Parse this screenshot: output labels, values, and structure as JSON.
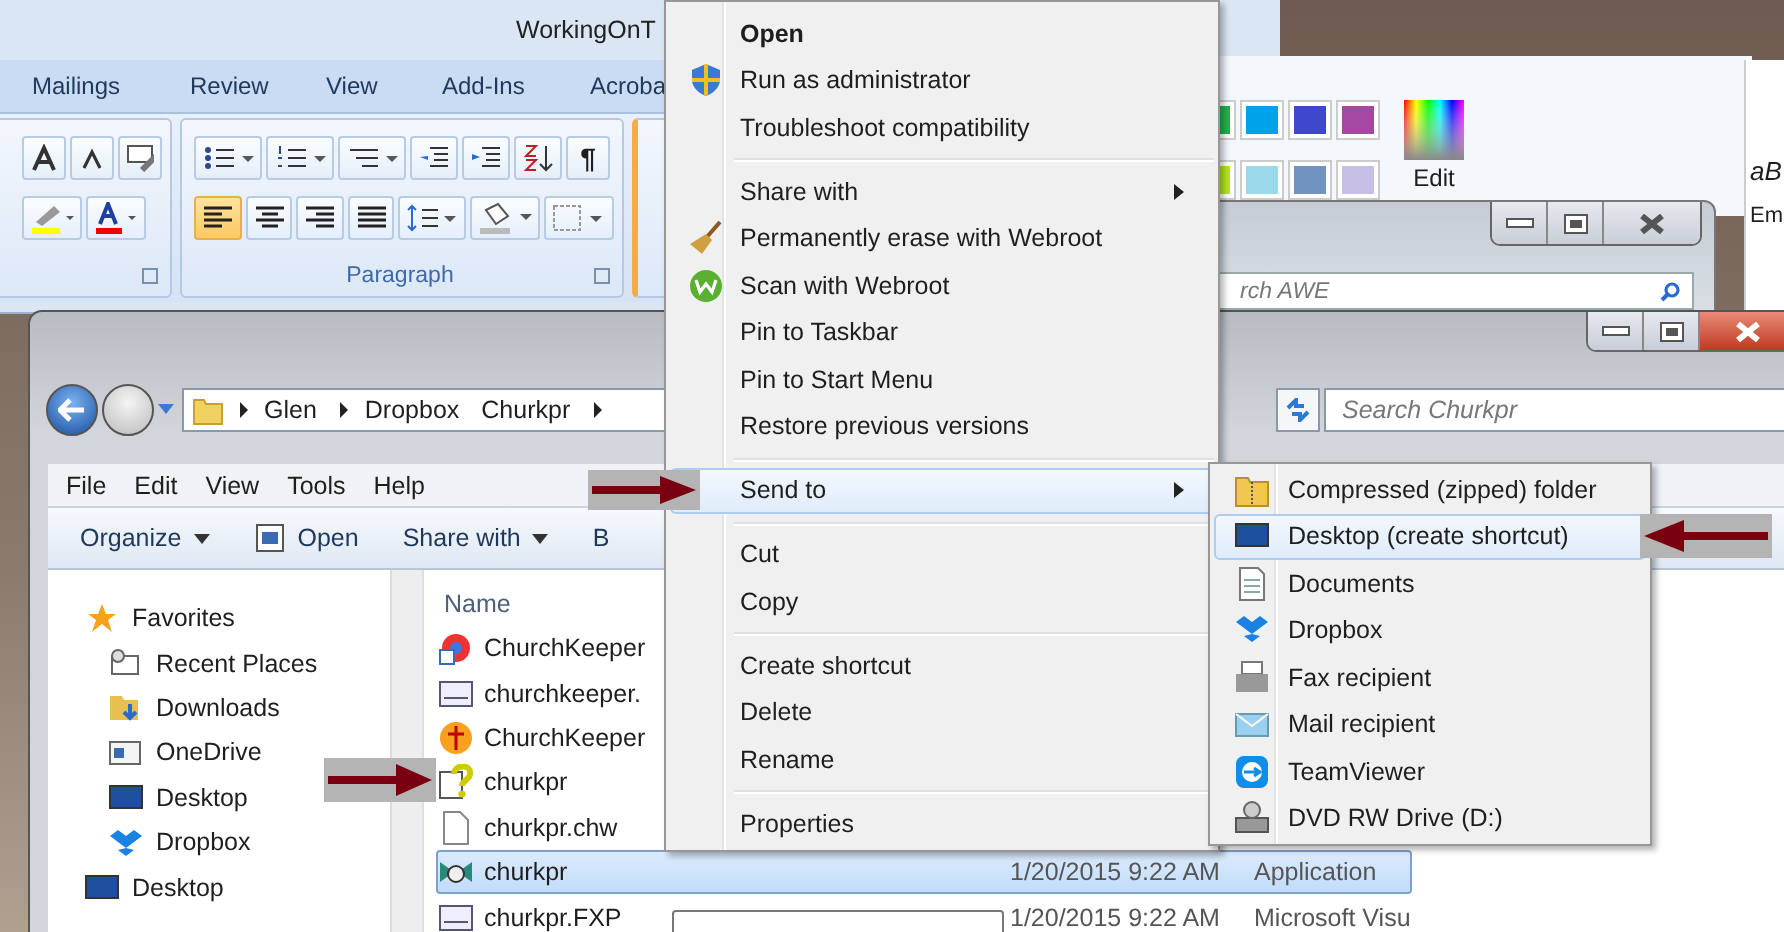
{
  "word_window": {
    "title": "WorkingOnT",
    "tabs": [
      "Mailings",
      "Review",
      "View",
      "Add-Ins",
      "Acroba"
    ],
    "show_marks_glyph": "¶",
    "group_label": "Paragraph",
    "alignments": [
      {
        "selected": true
      },
      {
        "selected": false
      },
      {
        "selected": false
      },
      {
        "selected": false
      }
    ]
  },
  "paint_window": {
    "edit_label": "Edit",
    "palette": [
      {
        "color": "#22b14c"
      },
      {
        "color": "#00a2e8"
      },
      {
        "color": "#3f48cc"
      },
      {
        "color": "#a349a4"
      },
      {
        "color": "#b5e61d"
      },
      {
        "color": "#99d9ea"
      },
      {
        "color": "#7092be"
      },
      {
        "color": "#c8bfe7"
      }
    ]
  },
  "awe_window": {
    "search_text": "rch AWE"
  },
  "document_edge_texts": [
    "aB",
    "Em"
  ],
  "explorer": {
    "breadcrumb": [
      {
        "label": "Glen",
        "arrow_before": true
      },
      {
        "label": "Dropbox",
        "arrow_before": true
      },
      {
        "label": "Churkpr",
        "arrow_before": false
      }
    ],
    "search_placeholder": "Search Churkpr",
    "menu": [
      "File",
      "Edit",
      "View",
      "Tools",
      "Help"
    ],
    "toolbar": [
      {
        "label": "Organize",
        "dropdown": true
      },
      {
        "label": "Open",
        "dropdown": false
      },
      {
        "label": "Share with",
        "dropdown": true
      },
      {
        "label": "B",
        "dropdown": false
      }
    ],
    "nav": [
      {
        "label": "Favorites",
        "kind": "header"
      },
      {
        "label": "Recent Places",
        "kind": "item"
      },
      {
        "label": "Downloads",
        "kind": "item"
      },
      {
        "label": "OneDrive",
        "kind": "item"
      },
      {
        "label": "Desktop",
        "kind": "item"
      },
      {
        "label": "Dropbox",
        "kind": "item"
      },
      {
        "label": "Desktop",
        "kind": "header"
      }
    ],
    "column": "Name",
    "files": [
      {
        "name": "ChurchKeeper",
        "selected": false
      },
      {
        "name": "churchkeeper.",
        "selected": false
      },
      {
        "name": "ChurchKeeper",
        "selected": false
      },
      {
        "name": "churkpr",
        "selected": false
      },
      {
        "name": "churkpr.chw",
        "selected": false
      },
      {
        "name": "churkpr",
        "date": "1/20/2015 9:22 AM",
        "type": "Application",
        "selected": true
      },
      {
        "name": "churkpr.FXP",
        "date": "1/20/2015 9:22 AM",
        "type": "Microsoft Visu",
        "selected": false
      }
    ]
  },
  "context_menu": {
    "items": [
      {
        "kind": "item",
        "label": "Open",
        "bold": true,
        "submenu": false,
        "selected": false
      },
      {
        "kind": "item",
        "label": "Run as administrator",
        "bold": false,
        "submenu": false,
        "selected": false
      },
      {
        "kind": "item",
        "label": "Troubleshoot compatibility",
        "bold": false,
        "submenu": false,
        "selected": false
      },
      {
        "kind": "separator"
      },
      {
        "kind": "item",
        "label": "Share with",
        "bold": false,
        "submenu": true,
        "selected": false
      },
      {
        "kind": "item",
        "label": "Permanently erase with Webroot",
        "bold": false,
        "submenu": false,
        "selected": false
      },
      {
        "kind": "item",
        "label": "Scan with Webroot",
        "bold": false,
        "submenu": false,
        "selected": false
      },
      {
        "kind": "item",
        "label": "Pin to Taskbar",
        "bold": false,
        "submenu": false,
        "selected": false
      },
      {
        "kind": "item",
        "label": "Pin to Start Menu",
        "bold": false,
        "submenu": false,
        "selected": false
      },
      {
        "kind": "item",
        "label": "Restore previous versions",
        "bold": false,
        "submenu": false,
        "selected": false
      },
      {
        "kind": "separator"
      },
      {
        "kind": "item",
        "label": "Send to",
        "bold": false,
        "submenu": true,
        "selected": true
      },
      {
        "kind": "separator"
      },
      {
        "kind": "item",
        "label": "Cut",
        "bold": false,
        "submenu": false,
        "selected": false
      },
      {
        "kind": "item",
        "label": "Copy",
        "bold": false,
        "submenu": false,
        "selected": false
      },
      {
        "kind": "separator"
      },
      {
        "kind": "item",
        "label": "Create shortcut",
        "bold": false,
        "submenu": false,
        "selected": false
      },
      {
        "kind": "item",
        "label": "Delete",
        "bold": false,
        "submenu": false,
        "selected": false
      },
      {
        "kind": "item",
        "label": "Rename",
        "bold": false,
        "submenu": false,
        "selected": false
      },
      {
        "kind": "separator"
      },
      {
        "kind": "item",
        "label": "Properties",
        "bold": false,
        "submenu": false,
        "selected": false
      }
    ]
  },
  "send_to_menu": {
    "items": [
      {
        "label": "Compressed (zipped) folder",
        "selected": false
      },
      {
        "label": "Desktop (create shortcut)",
        "selected": true
      },
      {
        "label": "Documents",
        "selected": false
      },
      {
        "label": "Dropbox",
        "selected": false
      },
      {
        "label": "Fax recipient",
        "selected": false
      },
      {
        "label": "Mail recipient",
        "selected": false
      },
      {
        "label": "TeamViewer",
        "selected": false
      },
      {
        "label": "DVD RW Drive (D:)",
        "selected": false
      }
    ]
  }
}
